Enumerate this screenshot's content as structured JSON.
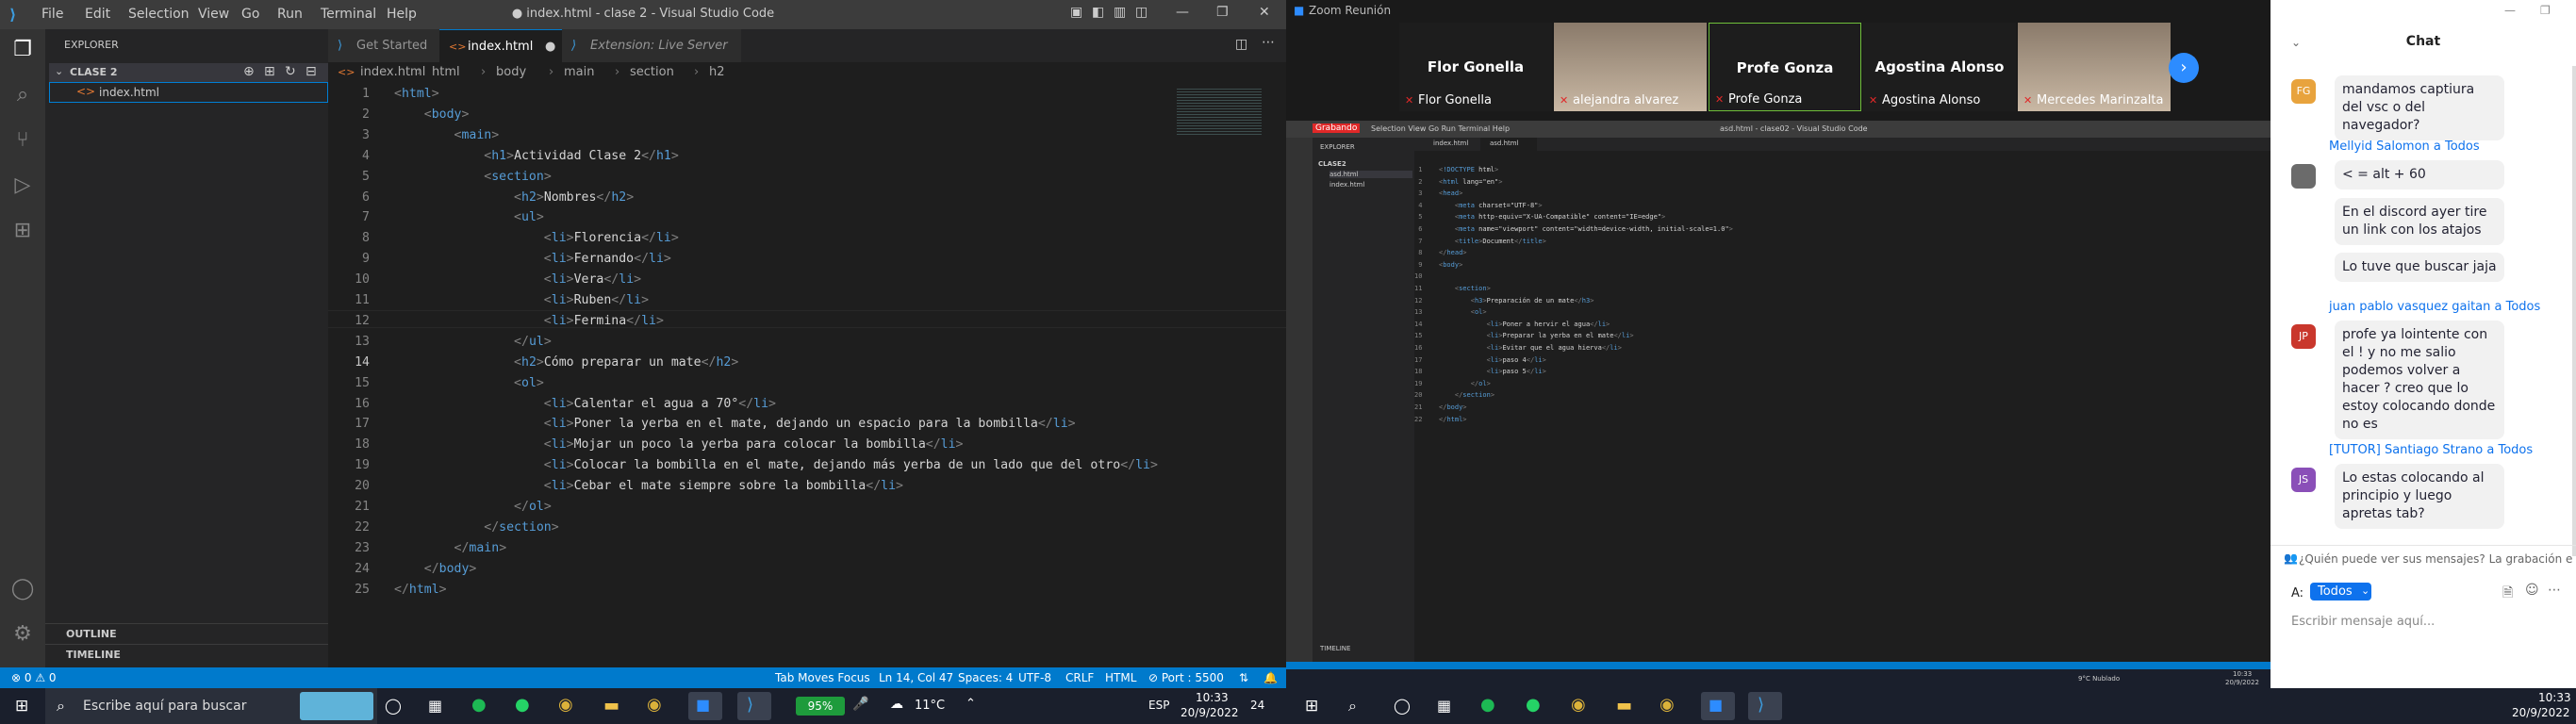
{
  "vscode": {
    "menu": [
      "File",
      "Edit",
      "Selection",
      "View",
      "Go",
      "Run",
      "Terminal",
      "Help"
    ],
    "title": "● index.html - clase 2 - Visual Studio Code",
    "explorer_title": "EXPLORER",
    "folder": "CLASE 2",
    "file": "index.html",
    "outline": "OUTLINE",
    "timeline": "TIMELINE",
    "tabs": [
      "Get Started",
      "index.html",
      "Extension: Live Server"
    ],
    "breadcrumb": [
      "index.html",
      "html",
      "body",
      "main",
      "section",
      "h2"
    ],
    "lines": [
      "<html>",
      "    <body>",
      "        <main>",
      "            <h1>Actividad Clase 2</h1>",
      "            <section>",
      "                <h2>Nombres</h2>",
      "                <ul>",
      "                    <li>Florencia</li>",
      "                    <li>Fernando</li>",
      "                    <li>Vera</li>",
      "                    <li>Ruben</li>",
      "                    <li>Fermina</li>",
      "                </ul>",
      "                <h2>Cómo preparar un mate</h2>",
      "                <ol>",
      "                    <li>Calentar el agua a 70°</li>",
      "                    <li>Poner la yerba en el mate, dejando un espacio para la bombilla</li>",
      "                    <li>Mojar un poco la yerba para colocar la bombilla</li>",
      "                    <li>Colocar la bombilla en el mate, dejando más yerba de un lado que del otro</li>",
      "                    <li>Cebar el mate siempre sobre la bombilla</li>",
      "                </ol>",
      "            </section>",
      "        </main>",
      "    </body>",
      "</html>"
    ],
    "status": {
      "errors": "⊗ 0 ⚠ 0",
      "tab_moves": "Tab Moves Focus",
      "position": "Ln 14, Col 47",
      "spaces": "Spaces: 4",
      "encoding": "UTF-8",
      "eol": "CRLF",
      "lang": "HTML",
      "port": "⊘ Port : 5500"
    }
  },
  "taskbar_left": {
    "search_placeholder": "Escribe aquí para buscar",
    "battery": "95%",
    "weather": "11°C",
    "lang": "ESP",
    "time": "10:33",
    "date": "20/9/2022",
    "notif": "24"
  },
  "zoom": {
    "title": "Zoom Reunión",
    "participants": [
      {
        "big": "Flor Gonella",
        "small": "Flor Gonella"
      },
      {
        "big": "",
        "small": "alejandra alvarez"
      },
      {
        "big": "Profe Gonza",
        "small": "Profe Gonza"
      },
      {
        "big": "Agostina Alonso",
        "small": "Agostina Alonso"
      },
      {
        "big": "",
        "small": "Mercedes Marinzalta"
      }
    ],
    "recording": "Grabando",
    "shared": {
      "tabs": [
        "index.html",
        "asd.html"
      ],
      "folder": "CLASE2",
      "files": [
        "asd.html",
        "index.html"
      ],
      "lines": [
        "<!DOCTYPE html>",
        "<html lang=\"en\">",
        "<head>",
        "    <meta charset=\"UTF-8\">",
        "    <meta http-equiv=\"X-UA-Compatible\" content=\"IE=edge\">",
        "    <meta name=\"viewport\" content=\"width=device-width, initial-scale=1.0\">",
        "    <title>Document</title>",
        "</head>",
        "<body>",
        "",
        "    <section>",
        "        <h3>Preparación de un mate</h3>",
        "        <ol>",
        "            <li>Poner a hervir el agua</li>",
        "            <li>Preparar la yerba en el mate</li>",
        "            <li>Evitar que el agua hierva</li>",
        "            <li>paso 4</li>",
        "            <li>paso 5</li>",
        "        </ol>",
        "    </section>",
        "</body>",
        "</html>"
      ],
      "timeline": "TIMELINE",
      "taskbar_time": "10:33",
      "taskbar_date": "20/9/2022",
      "weather": "9°C Nublado"
    }
  },
  "chat": {
    "title": "Chat",
    "messages": [
      {
        "type": "bubble",
        "avatar": "FG",
        "color": "#e8a33d",
        "text": "mandamos captiura del vsc o del navegador?"
      },
      {
        "type": "sender",
        "text": "Mellyid Salomon a Todos"
      },
      {
        "type": "bubble",
        "avatar": "",
        "color": "#6b6b6b",
        "text": "< = alt + 60"
      },
      {
        "type": "bubble",
        "avatar": "",
        "color": "",
        "text": "En el discord ayer tire un link con los atajos"
      },
      {
        "type": "bubble",
        "avatar": "",
        "color": "",
        "text": "Lo tuve que buscar jaja"
      },
      {
        "type": "sender",
        "text": "juan pablo vasquez gaitan a Todos"
      },
      {
        "type": "bubble",
        "avatar": "JP",
        "color": "#c9372c",
        "text": "profe  ya lointente con el ! y no me salio podemos volver a hacer ? creo que lo estoy colocando donde no es"
      },
      {
        "type": "sender",
        "text": "[TUTOR] Santiago Strano a Todos"
      },
      {
        "type": "bubble",
        "avatar": "JS",
        "color": "#8a4fb8",
        "text": "Lo estas colocando al principio y luego apretas tab?"
      }
    ],
    "notice": "¿Quién puede ver sus mensajes? La grabación está habilit",
    "to_label": "A:",
    "to_value": "Todos",
    "input_placeholder": "Escribir mensaje aquí..."
  },
  "taskbar_right": {
    "time": "10:33",
    "date": "20/9/2022"
  }
}
